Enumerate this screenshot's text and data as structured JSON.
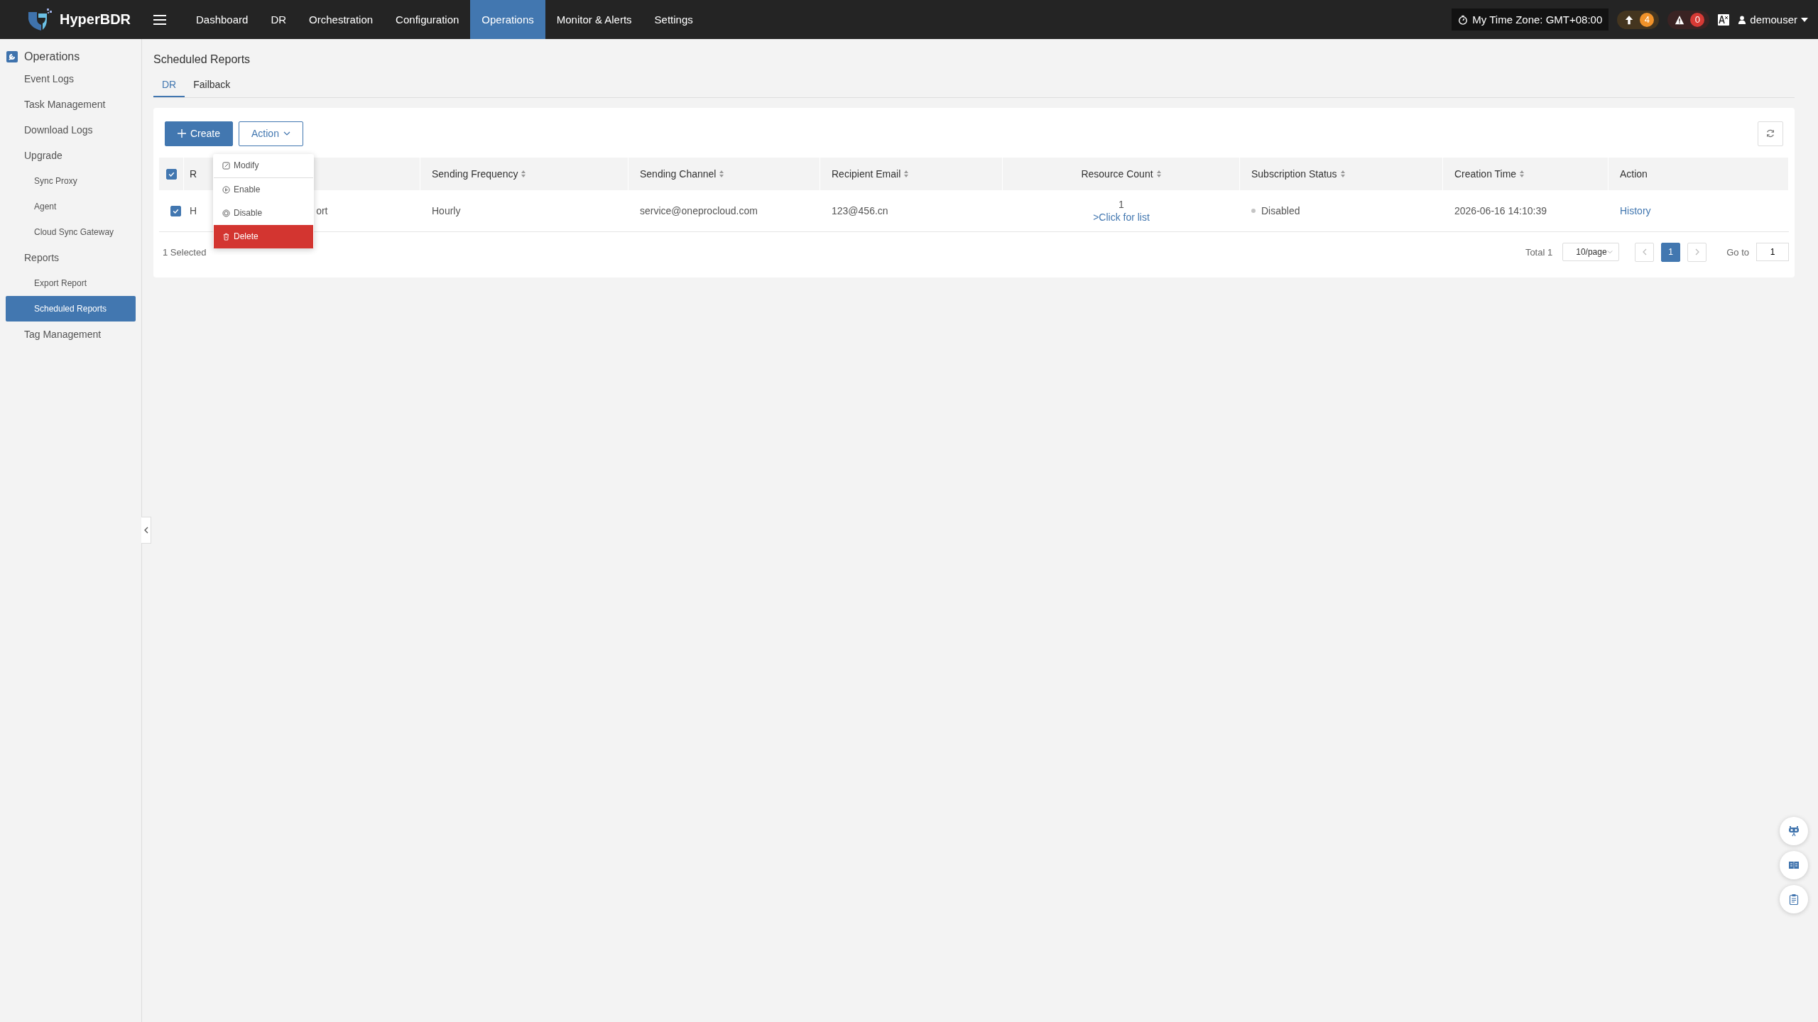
{
  "topbar": {
    "brand": "HyperBDR",
    "nav": [
      {
        "label": "Dashboard",
        "selected": false
      },
      {
        "label": "DR",
        "selected": false
      },
      {
        "label": "Orchestration",
        "selected": false
      },
      {
        "label": "Configuration",
        "selected": false
      },
      {
        "label": "Operations",
        "selected": true
      },
      {
        "label": "Monitor & Alerts",
        "selected": false
      },
      {
        "label": "Settings",
        "selected": false
      }
    ],
    "timezone": "My Time Zone: GMT+08:00",
    "upload_count": "4",
    "alert_count": "0",
    "user": "demouser"
  },
  "sidebar": {
    "title": "Operations",
    "items": [
      {
        "label": "Event Logs",
        "selected": false
      },
      {
        "label": "Task Management",
        "selected": false
      },
      {
        "label": "Download Logs",
        "selected": false
      },
      {
        "label": "Upgrade",
        "selected": false,
        "children": [
          {
            "label": "Sync Proxy",
            "selected": false
          },
          {
            "label": "Agent",
            "selected": false
          },
          {
            "label": "Cloud Sync Gateway",
            "selected": false
          }
        ]
      },
      {
        "label": "Reports",
        "selected": false,
        "children": [
          {
            "label": "Export Report",
            "selected": false
          },
          {
            "label": "Scheduled Reports",
            "selected": true
          }
        ]
      },
      {
        "label": "Tag Management",
        "selected": false
      }
    ]
  },
  "page": {
    "title": "Scheduled Reports",
    "tabs": [
      {
        "label": "DR",
        "selected": true
      },
      {
        "label": "Failback",
        "selected": false
      }
    ]
  },
  "toolbar": {
    "create": "Create",
    "action": "Action"
  },
  "action_menu": {
    "items": [
      {
        "label": "Modify",
        "kind": "modify",
        "highlighted": false
      },
      {
        "label": "Enable",
        "kind": "enable",
        "highlighted": false
      },
      {
        "label": "Disable",
        "kind": "disable",
        "highlighted": false
      },
      {
        "label": "Delete",
        "kind": "delete",
        "highlighted": true
      }
    ]
  },
  "table": {
    "select_all_checked": true,
    "columns": [
      {
        "label": "R",
        "sortable": false
      },
      {
        "label": "Sending Frequency",
        "sortable": true
      },
      {
        "label": "Sending Channel",
        "sortable": true
      },
      {
        "label": "Recipient Email",
        "sortable": true
      },
      {
        "label": "Resource Count",
        "sortable": true
      },
      {
        "label": "Subscription Status",
        "sortable": true
      },
      {
        "label": "Creation Time",
        "sortable": true
      },
      {
        "label": "Action",
        "sortable": false
      }
    ],
    "rows": [
      {
        "checked": true,
        "name_parts": [
          "H",
          "ort"
        ],
        "frequency": "Hourly",
        "channel": "service@oneprocloud.com",
        "email": "123@456.cn",
        "resource_count": "1",
        "resource_link": ">Click for list",
        "status": "Disabled",
        "color": "#c4c4c4",
        "created": "2026-06-16 14:10:39",
        "action": "History"
      }
    ]
  },
  "selection_note": "1 Selected",
  "pagination": {
    "total": "Total 1",
    "page_size": "10/page",
    "pages": [
      {
        "label": "1",
        "selected": true
      }
    ],
    "goto_label": "Go to",
    "goto_value": "1"
  }
}
